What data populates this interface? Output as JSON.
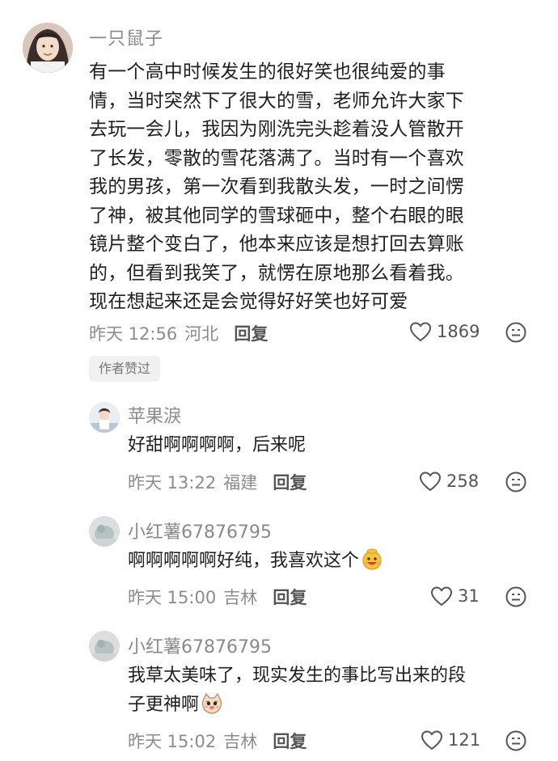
{
  "main_comment": {
    "username": "一只鼠子",
    "text_lines": [
      "有一个高中时候发生的很好笑也很纯爱的事",
      "情，当时突然下了很大的雪，老师允许大家下",
      "去玩一会儿，我因为刚洗完头趁着没人管散开",
      "了长发，零散的雪花落满了。当时有一个喜欢",
      "我的男孩，第一次看到我散头发，一时之间愣",
      "了神，被其他同学的雪球砸中，整个右眼的眼",
      "镜片整个变白了，他本来应该是想打回去算账",
      "的，但看到我笑了，就愣在原地那么看着我。",
      "现在想起来还是会觉得好好笑也好可爱"
    ],
    "time": "昨天 12:56",
    "location": "河北",
    "reply_label": "回复",
    "likes": "1869",
    "badge": "作者赞过"
  },
  "replies": [
    {
      "username": "苹果淚",
      "text_lines": [
        "好甜啊啊啊啊，后来呢"
      ],
      "time": "昨天 13:22",
      "location": "福建",
      "reply_label": "回复",
      "likes": "258"
    },
    {
      "username": "小红薯67876795",
      "text_lines": [
        "啊啊啊啊啊好纯，我喜欢这个"
      ],
      "emoji": "grinning-face-emoji",
      "time": "昨天 15:00",
      "location": "吉林",
      "reply_label": "回复",
      "likes": "31"
    },
    {
      "username": "小红薯67876795",
      "text_lines": [
        "我草太美味了，现实发生的事比写出来的段",
        "子更神啊"
      ],
      "emoji": "cat-face-emoji",
      "time": "昨天 15:02",
      "location": "吉林",
      "reply_label": "回复",
      "likes": "121"
    }
  ],
  "colors": {
    "meta_gray": "#8c8c8c",
    "text_dark": "#1f1f1f",
    "badge_bg": "#f1f1f1"
  }
}
